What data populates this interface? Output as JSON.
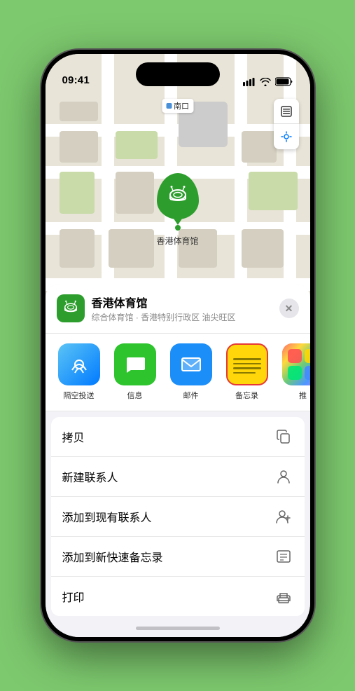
{
  "status_bar": {
    "time": "09:41",
    "location_icon": "arrow-up-right"
  },
  "map": {
    "label": "南口",
    "controls": [
      "map-layers-icon",
      "location-arrow-icon"
    ]
  },
  "venue": {
    "name": "香港体育馆",
    "subtitle": "综合体育馆 · 香港特别行政区 油尖旺区",
    "close_label": "✕"
  },
  "share_items": [
    {
      "id": "airdrop",
      "label": "隔空投送"
    },
    {
      "id": "message",
      "label": "信息"
    },
    {
      "id": "mail",
      "label": "邮件"
    },
    {
      "id": "notes",
      "label": "备忘录"
    },
    {
      "id": "more",
      "label": "推"
    }
  ],
  "actions": [
    {
      "label": "拷贝",
      "icon": "copy"
    },
    {
      "label": "新建联系人",
      "icon": "person"
    },
    {
      "label": "添加到现有联系人",
      "icon": "person-add"
    },
    {
      "label": "添加到新快速备忘录",
      "icon": "note"
    },
    {
      "label": "打印",
      "icon": "print"
    }
  ]
}
